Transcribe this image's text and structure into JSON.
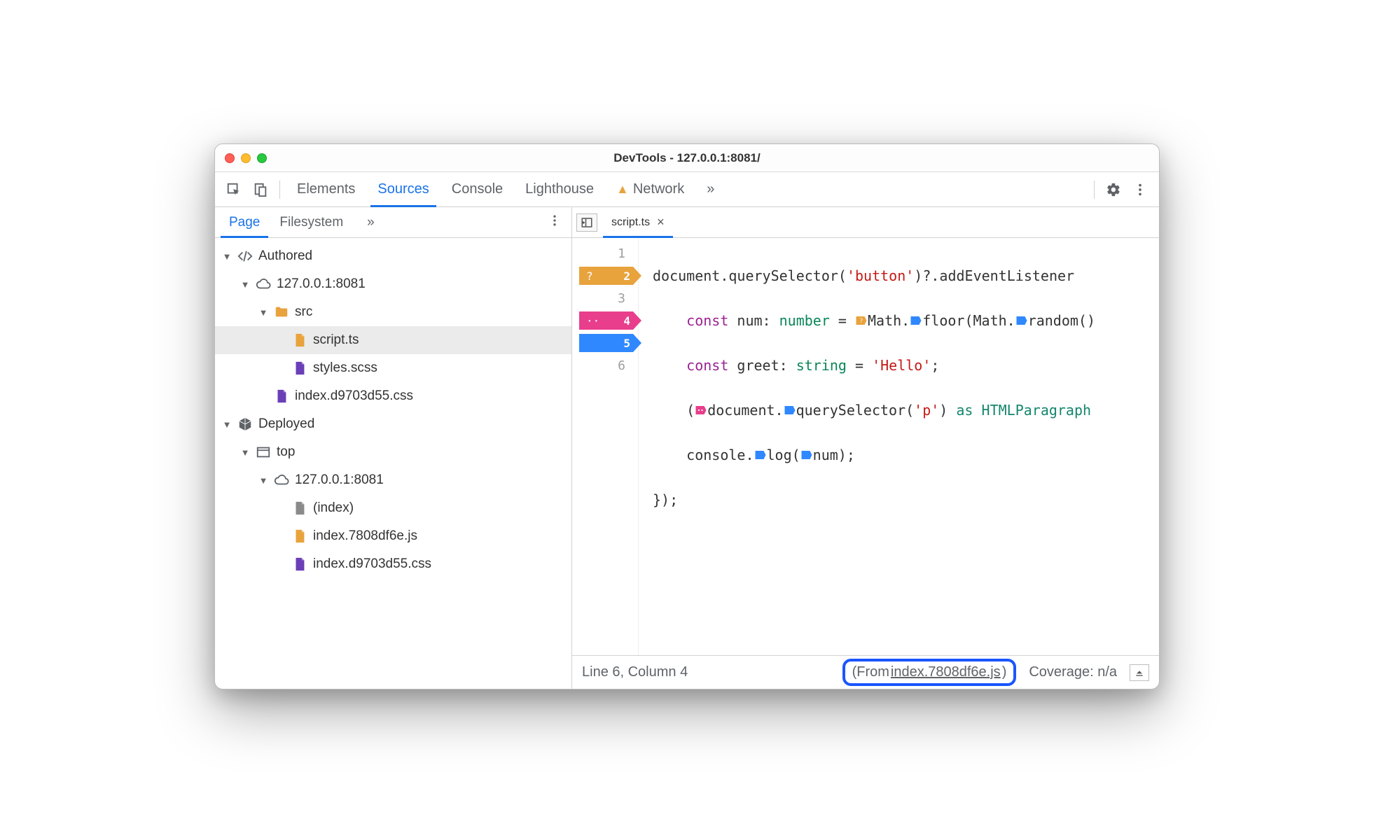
{
  "window": {
    "title": "DevTools - 127.0.0.1:8081/"
  },
  "toolbar": {
    "tabs": {
      "elements": "Elements",
      "sources": "Sources",
      "console": "Console",
      "lighthouse": "Lighthouse",
      "network": "Network"
    },
    "more": "»"
  },
  "sidebar": {
    "tabs": {
      "page": "Page",
      "filesystem": "Filesystem",
      "more": "»"
    },
    "tree": {
      "authored": "Authored",
      "host1": "127.0.0.1:8081",
      "src": "src",
      "script": "script.ts",
      "styles": "styles.scss",
      "css1": "index.d9703d55.css",
      "deployed": "Deployed",
      "top": "top",
      "host2": "127.0.0.1:8081",
      "index": "(index)",
      "js": "index.7808df6e.js",
      "css2": "index.d9703d55.css"
    }
  },
  "editor": {
    "tab": {
      "name": "script.ts"
    },
    "gutter": {
      "l1": "1",
      "l2": "2",
      "l3": "3",
      "l4": "4",
      "l5": "5",
      "l6": "6",
      "bp2_mark": "?",
      "bp4_mark": "··"
    },
    "code": {
      "l1a": "document.querySelector(",
      "l1b": "'button'",
      "l1c": ")?.addEventListener",
      "l2pad": "    ",
      "l2a": "const",
      "l2b": " num: ",
      "l2c": "number",
      "l2d": " = ",
      "l2e": "Math.",
      "l2f": "floor(Math.",
      "l2g": "random()",
      "l3pad": "    ",
      "l3a": "const",
      "l3b": " greet: ",
      "l3c": "string",
      "l3d": " = ",
      "l3e": "'Hello'",
      "l3f": ";",
      "l4pad": "    (",
      "l4a": "document.",
      "l4b": "querySelector(",
      "l4c": "'p'",
      "l4d": ") ",
      "l4e": "as",
      "l4f": " HTMLParagraph",
      "l5pad": "    ",
      "l5a": "console.",
      "l5b": "log(",
      "l5c": "num);",
      "l6": "});"
    }
  },
  "status": {
    "pos": "Line 6, Column 4",
    "from_prefix": "(From ",
    "from_link": "index.7808df6e.js",
    "from_suffix": ")",
    "coverage": "Coverage: n/a"
  }
}
